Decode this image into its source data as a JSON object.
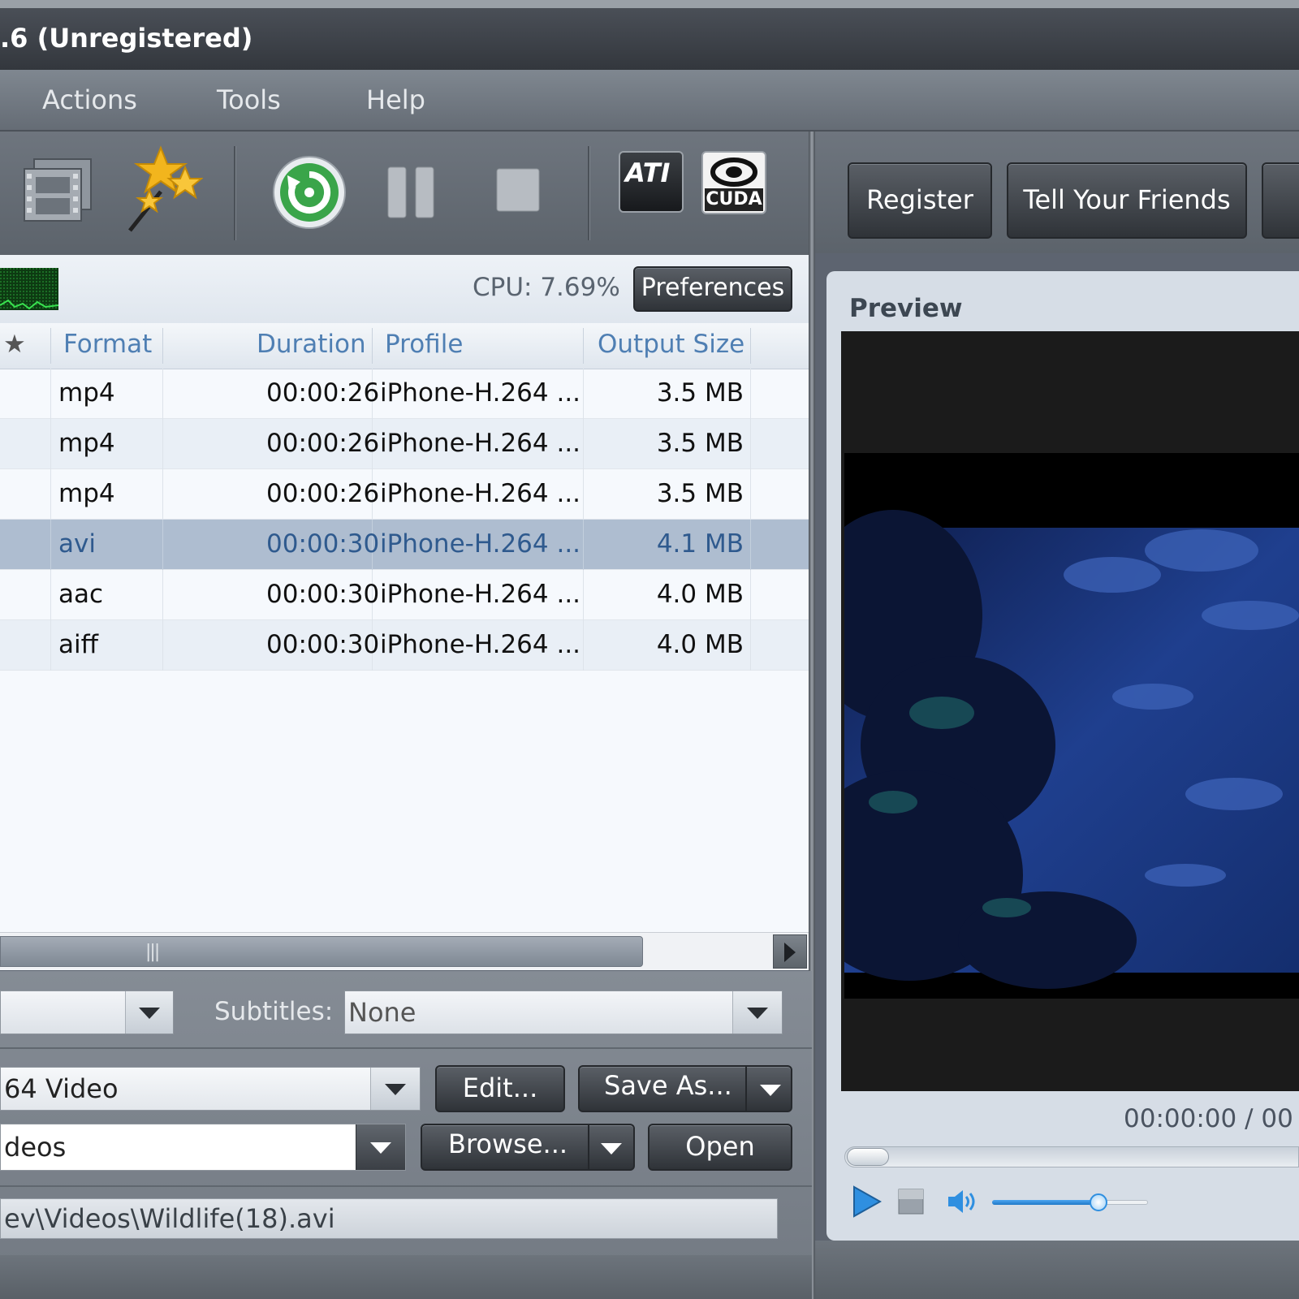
{
  "window": {
    "title": ".6 (Unregistered)"
  },
  "menu": {
    "items": [
      "Actions",
      "Tools",
      "Help"
    ]
  },
  "toolbar": {
    "cuda_label": "CUDA",
    "ati_label": "ATI"
  },
  "header_buttons": {
    "register": "Register",
    "tell_friends": "Tell Your Friends"
  },
  "status": {
    "cpu": "CPU: 7.69%",
    "preferences": "Preferences"
  },
  "table": {
    "star_header": "★",
    "headers": {
      "format": "Format",
      "duration": "Duration",
      "profile": "Profile",
      "output_size": "Output Size"
    },
    "rows": [
      {
        "format": "mp4",
        "duration": "00:00:26",
        "profile": "iPhone-H.264 ...",
        "size": "3.5 MB"
      },
      {
        "format": "mp4",
        "duration": "00:00:26",
        "profile": "iPhone-H.264 ...",
        "size": "3.5 MB"
      },
      {
        "format": "mp4",
        "duration": "00:00:26",
        "profile": "iPhone-H.264 ...",
        "size": "3.5 MB"
      },
      {
        "format": "avi",
        "duration": "00:00:30",
        "profile": "iPhone-H.264 ...",
        "size": "4.1 MB",
        "selected": true
      },
      {
        "format": "aac",
        "duration": "00:00:30",
        "profile": "iPhone-H.264 ...",
        "size": "4.0 MB"
      },
      {
        "format": "aiff",
        "duration": "00:00:30",
        "profile": "iPhone-H.264 ...",
        "size": "4.0 MB"
      }
    ]
  },
  "subtitles": {
    "label": "Subtitles:",
    "value": "None"
  },
  "profile": {
    "value": "64 Video",
    "edit": "Edit...",
    "save_as": "Save As..."
  },
  "destination": {
    "value": "deos",
    "browse": "Browse...",
    "open": "Open"
  },
  "source_path": "ev\\Videos\\Wildlife(18).avi",
  "preview": {
    "label": "Preview",
    "time": "00:00:00 / 00",
    "volume_level": 0.68
  }
}
